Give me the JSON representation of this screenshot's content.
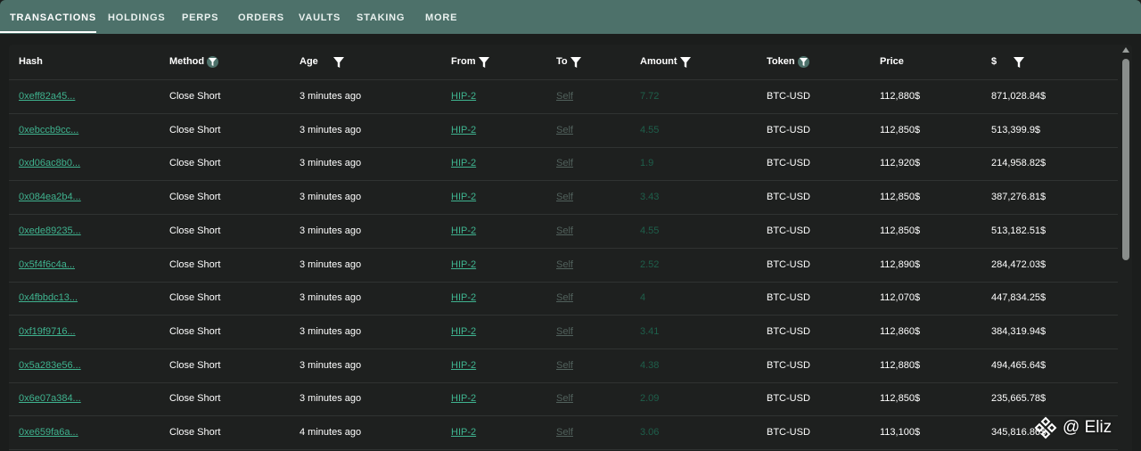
{
  "tabs": [
    {
      "label": "TRANSACTIONS",
      "active": true
    },
    {
      "label": "HOLDINGS"
    },
    {
      "label": "PERPS"
    },
    {
      "label": "ORDERS"
    },
    {
      "label": "VAULTS"
    },
    {
      "label": "STAKING"
    },
    {
      "label": "MORE"
    }
  ],
  "table": {
    "headers": {
      "hash": "Hash",
      "method": "Method",
      "age": "Age",
      "from": "From",
      "to": "To",
      "amount": "Amount",
      "token": "Token",
      "price": "Price",
      "usd": "$"
    },
    "rows": [
      {
        "hash": "0xeff82a45...",
        "method": "Close Short",
        "age": "3 minutes ago",
        "from": "HIP-2",
        "to": "Self",
        "amount": "7.72",
        "token": "BTC-USD",
        "price": "112,880$",
        "usd": "871,028.84$"
      },
      {
        "hash": "0xebccb9cc...",
        "method": "Close Short",
        "age": "3 minutes ago",
        "from": "HIP-2",
        "to": "Self",
        "amount": "4.55",
        "token": "BTC-USD",
        "price": "112,850$",
        "usd": "513,399.9$"
      },
      {
        "hash": "0xd06ac8b0...",
        "method": "Close Short",
        "age": "3 minutes ago",
        "from": "HIP-2",
        "to": "Self",
        "amount": "1.9",
        "token": "BTC-USD",
        "price": "112,920$",
        "usd": "214,958.82$"
      },
      {
        "hash": "0x084ea2b4...",
        "method": "Close Short",
        "age": "3 minutes ago",
        "from": "HIP-2",
        "to": "Self",
        "amount": "3.43",
        "token": "BTC-USD",
        "price": "112,850$",
        "usd": "387,276.81$"
      },
      {
        "hash": "0xede89235...",
        "method": "Close Short",
        "age": "3 minutes ago",
        "from": "HIP-2",
        "to": "Self",
        "amount": "4.55",
        "token": "BTC-USD",
        "price": "112,850$",
        "usd": "513,182.51$"
      },
      {
        "hash": "0x5f4f6c4a...",
        "method": "Close Short",
        "age": "3 minutes ago",
        "from": "HIP-2",
        "to": "Self",
        "amount": "2.52",
        "token": "BTC-USD",
        "price": "112,890$",
        "usd": "284,472.03$"
      },
      {
        "hash": "0x4fbbdc13...",
        "method": "Close Short",
        "age": "3 minutes ago",
        "from": "HIP-2",
        "to": "Self",
        "amount": "4",
        "token": "BTC-USD",
        "price": "112,070$",
        "usd": "447,834.25$"
      },
      {
        "hash": "0xf19f9716...",
        "method": "Close Short",
        "age": "3 minutes ago",
        "from": "HIP-2",
        "to": "Self",
        "amount": "3.41",
        "token": "BTC-USD",
        "price": "112,860$",
        "usd": "384,319.94$"
      },
      {
        "hash": "0x5a283e56...",
        "method": "Close Short",
        "age": "3 minutes ago",
        "from": "HIP-2",
        "to": "Self",
        "amount": "4.38",
        "token": "BTC-USD",
        "price": "112,880$",
        "usd": "494,465.64$"
      },
      {
        "hash": "0x6e07a384...",
        "method": "Close Short",
        "age": "3 minutes ago",
        "from": "HIP-2",
        "to": "Self",
        "amount": "2.09",
        "token": "BTC-USD",
        "price": "112,850$",
        "usd": "235,665.78$"
      },
      {
        "hash": "0xe659fa6a...",
        "method": "Close Short",
        "age": "4 minutes ago",
        "from": "HIP-2",
        "to": "Self",
        "amount": "3.06",
        "token": "BTC-USD",
        "price": "113,100$",
        "usd": "345,816.86$"
      }
    ]
  },
  "watermark": {
    "text": "@ Eliz"
  },
  "colors": {
    "tab_bar": "#4d716a",
    "link_green": "#3fb38f",
    "amount_green": "#1e5f4b",
    "self_gray": "#51615c",
    "panel_bg": "#1e201f"
  },
  "icons": {
    "filter": "filter-icon",
    "scroll_up": "scroll-up-arrow-icon",
    "logo": "diamond-logo-icon"
  }
}
